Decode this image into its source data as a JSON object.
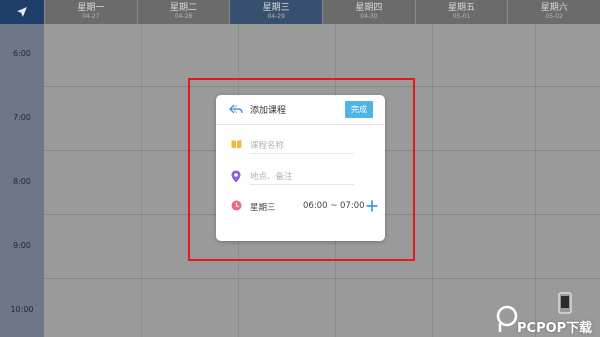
{
  "header": {
    "nav_icon": "send-arrow-icon",
    "days": [
      {
        "name": "星期一",
        "date": "04-27"
      },
      {
        "name": "星期二",
        "date": "04-28"
      },
      {
        "name": "星期三",
        "date": "04-29"
      },
      {
        "name": "星期四",
        "date": "04-30"
      },
      {
        "name": "星期五",
        "date": "05-01"
      },
      {
        "name": "星期六",
        "date": "05-02"
      }
    ],
    "active_day_index": 2
  },
  "timeline": {
    "hours": [
      "6:00",
      "7:00",
      "8:00",
      "9:00",
      "10:00"
    ]
  },
  "dialog": {
    "title": "添加课程",
    "back_icon": "reply-arrow-icon",
    "done_label": "完成",
    "course_name_placeholder": "课程名称",
    "location_placeholder": "地点、备注",
    "weekday": "星期三",
    "time_range": "06:00 ~ 07:00",
    "add_icon": "plus-icon",
    "book_icon": "book-icon",
    "location_icon": "location-pin-icon",
    "clock_icon": "clock-icon"
  },
  "watermark": {
    "text": "PCPOP下载",
    "icon": "phone-icon"
  },
  "colors": {
    "accent": "#4fb3e8",
    "highlight_border": "#e21c1c",
    "book_icon": "#f6b73c",
    "pin_icon": "#8e5fd6",
    "clock_icon": "#ee6a7d"
  }
}
